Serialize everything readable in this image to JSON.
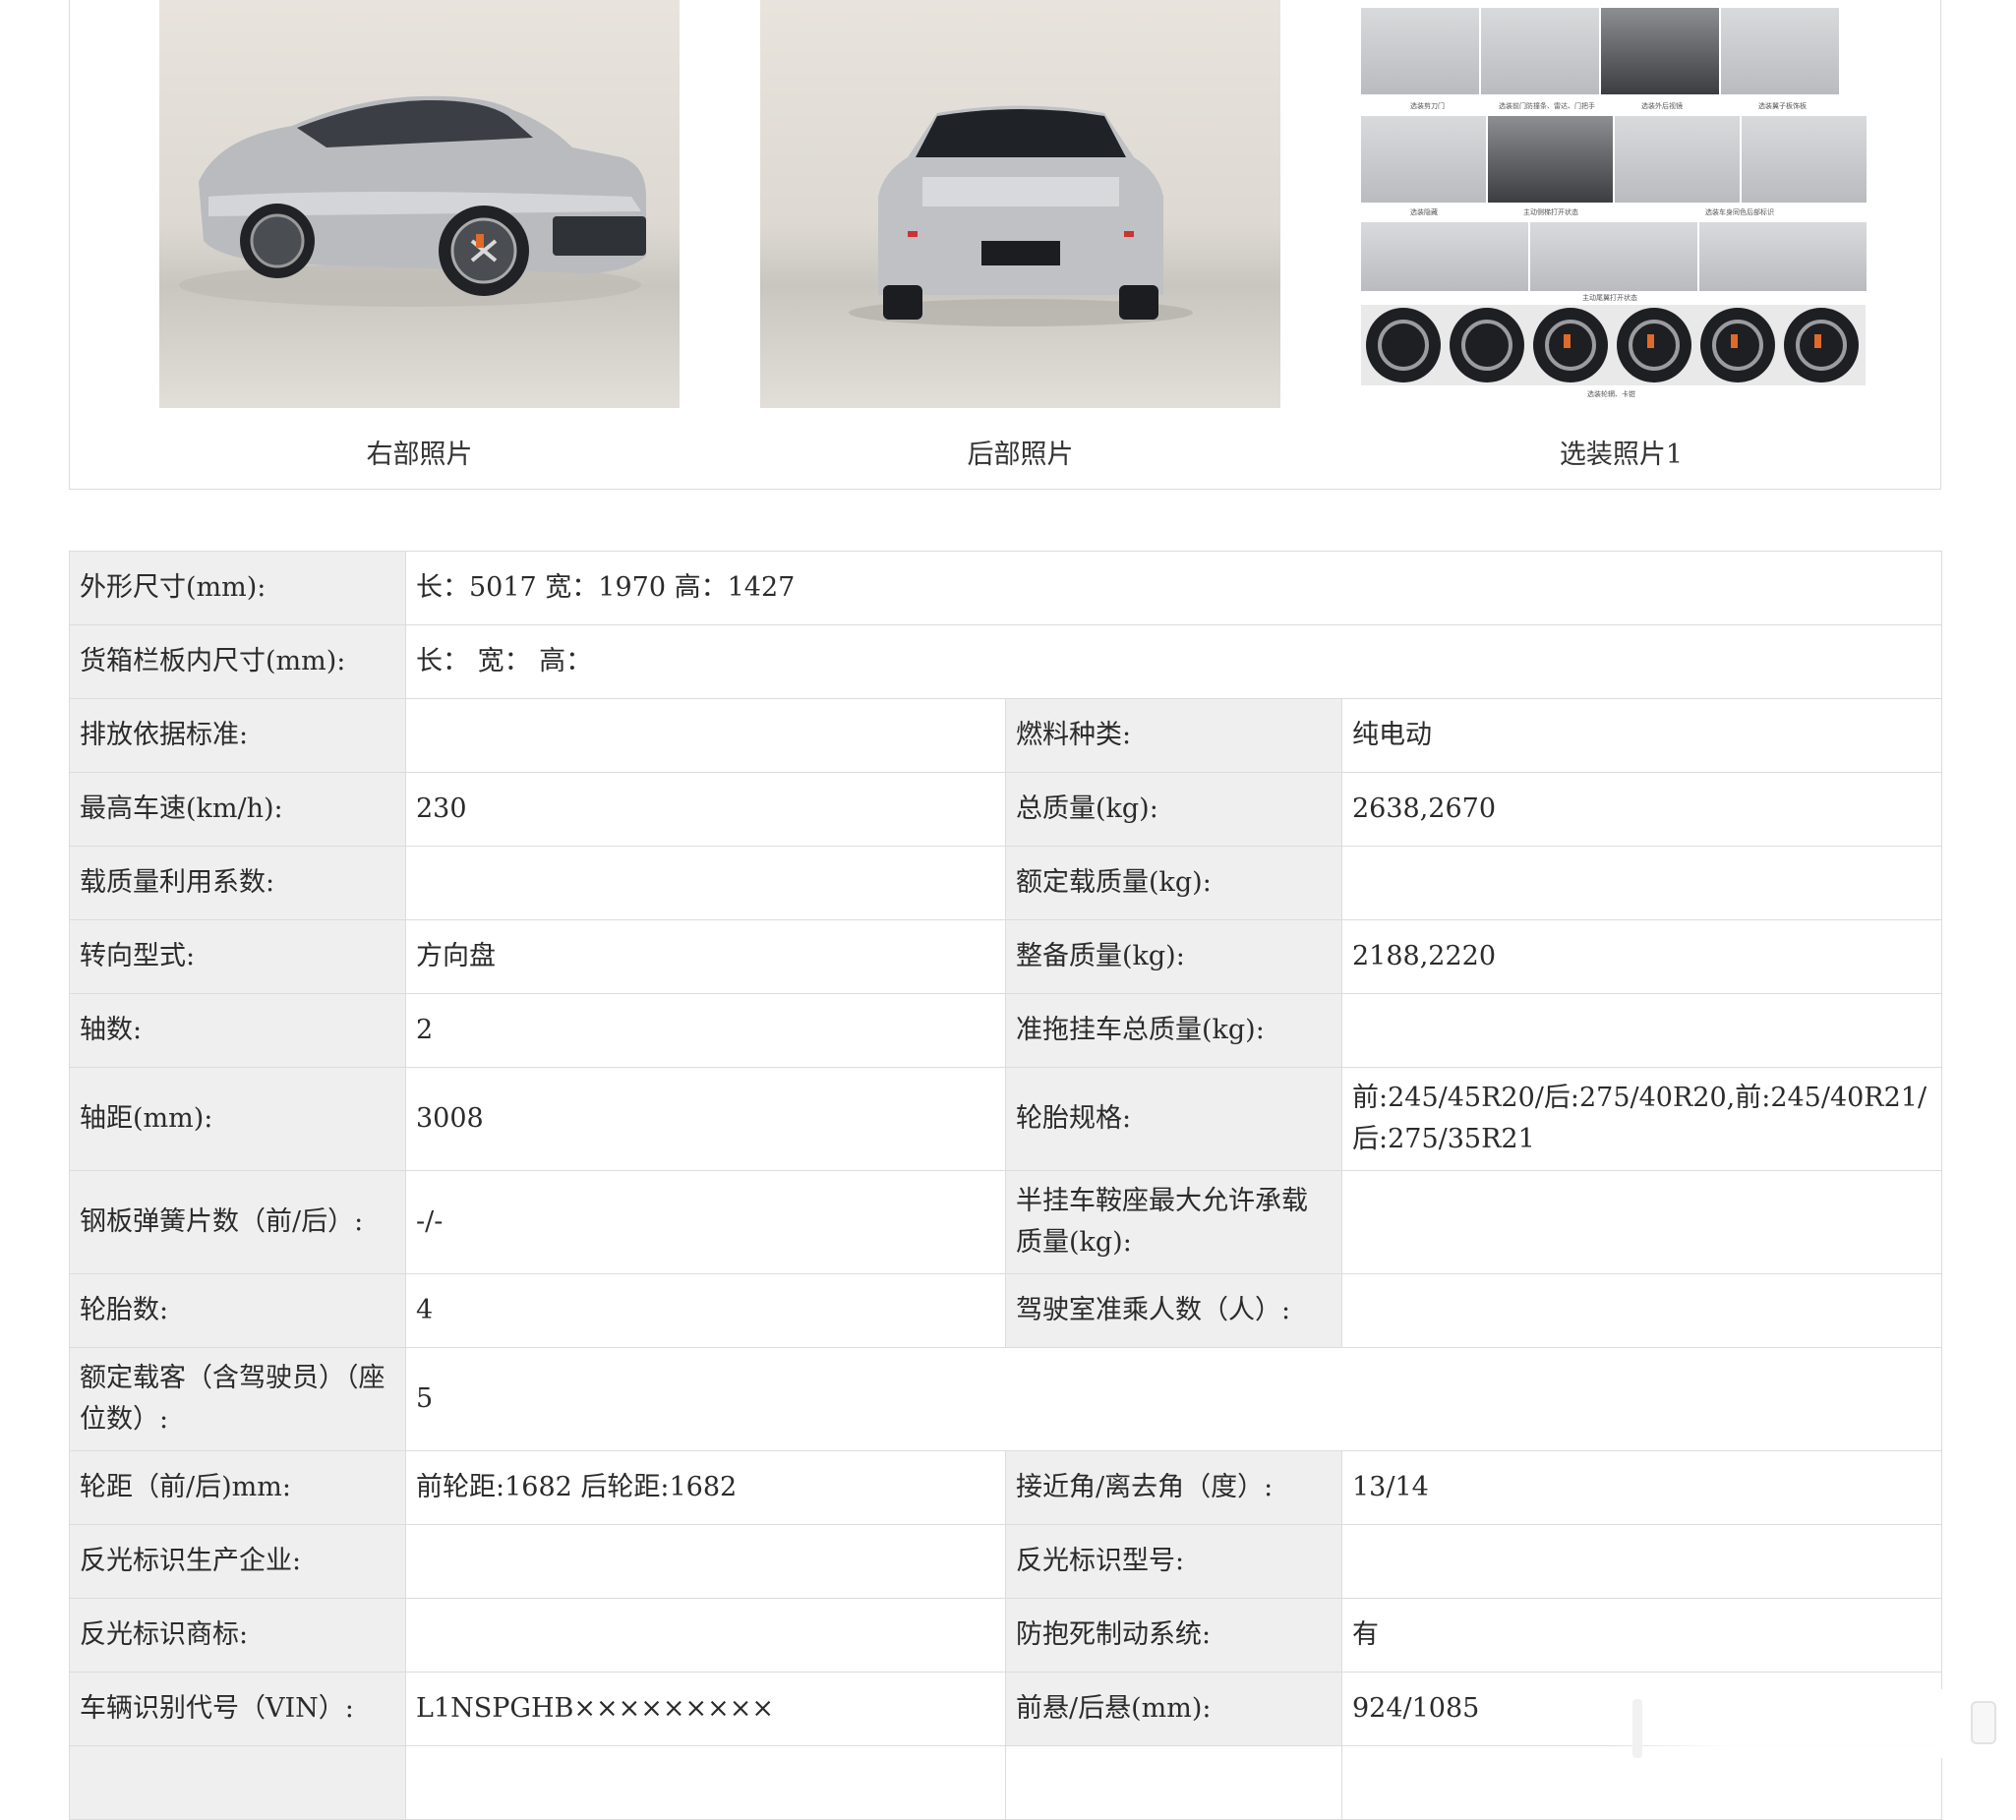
{
  "photos": [
    {
      "caption": "右部照片"
    },
    {
      "caption": "后部照片"
    },
    {
      "caption": "选装照片1"
    }
  ],
  "collage_captions": {
    "r1": [
      "选装剪刀门",
      "选装前门防撞条、雷达、门把手",
      "选装外后视镜",
      "选装翼子板饰板"
    ],
    "r2": [
      "选装隐藏",
      "主动侧梯打开状态",
      "选装车身同色后部标识"
    ],
    "r3": [
      "主动尾翼打开状态"
    ],
    "r4": [
      "选装轮辋、卡钳"
    ]
  },
  "spec": {
    "dimensions": {
      "label": "外形尺寸(mm):",
      "value": "长：5017 宽：1970 高：1427"
    },
    "cargo": {
      "label": "货箱栏板内尺寸(mm):",
      "value": "长：  宽：  高："
    },
    "emission": {
      "label": "排放依据标准:",
      "value": ""
    },
    "fuel": {
      "label": "燃料种类:",
      "value": "纯电动"
    },
    "max_speed": {
      "label": "最高车速(km/h):",
      "value": "230"
    },
    "gross_mass": {
      "label": "总质量(kg):",
      "value": "2638,2670"
    },
    "load_coeff": {
      "label": "载质量利用系数:",
      "value": ""
    },
    "rated_load": {
      "label": "额定载质量(kg):",
      "value": ""
    },
    "steering": {
      "label": "转向型式:",
      "value": "方向盘"
    },
    "curb_mass": {
      "label": "整备质量(kg):",
      "value": "2188,2220"
    },
    "axles": {
      "label": "轴数:",
      "value": "2"
    },
    "trailer_mass": {
      "label": "准拖挂车总质量(kg):",
      "value": ""
    },
    "wheelbase": {
      "label": "轴距(mm):",
      "value": "3008"
    },
    "tires": {
      "label": "轮胎规格:",
      "value": "前:245/45R20/后:275/40R20,前:245/40R21/后:275/35R21"
    },
    "leaf_springs": {
      "label": "钢板弹簧片数（前/后）:",
      "value": "-/-"
    },
    "saddle_load": {
      "label": "半挂车鞍座最大允许承载质量(kg):",
      "value": ""
    },
    "tire_count": {
      "label": "轮胎数:",
      "value": "4"
    },
    "cab_seats": {
      "label": "驾驶室准乘人数（人）:",
      "value": ""
    },
    "passengers": {
      "label": "额定载客（含驾驶员）（座位数）:",
      "value": "5"
    },
    "track": {
      "label": "轮距（前/后)mm:",
      "value": "前轮距:1682 后轮距:1682"
    },
    "angles": {
      "label": "接近角/离去角（度）:",
      "value": "13/14"
    },
    "reflector_maker": {
      "label": "反光标识生产企业:",
      "value": ""
    },
    "reflector_model": {
      "label": "反光标识型号:",
      "value": ""
    },
    "reflector_brand": {
      "label": "反光标识商标:",
      "value": ""
    },
    "abs": {
      "label": "防抱死制动系统:",
      "value": "有"
    },
    "vin": {
      "label": "车辆识别代号（VIN）:",
      "value": "L1NSPGHB×××××××××"
    },
    "overhang": {
      "label": "前悬/后悬(mm):",
      "value": "924/1085"
    }
  }
}
